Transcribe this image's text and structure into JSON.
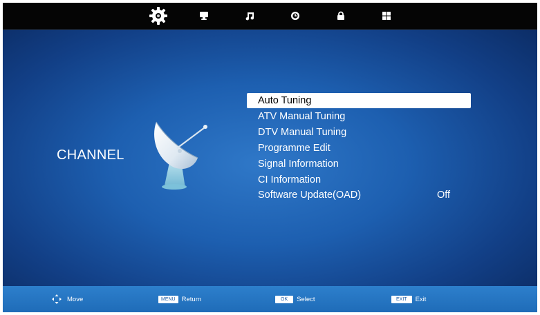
{
  "top_tabs": [
    {
      "icon": "gear-icon",
      "selected": true
    },
    {
      "icon": "monitor-icon",
      "selected": false
    },
    {
      "icon": "music-note-icon",
      "selected": false
    },
    {
      "icon": "clock-icon",
      "selected": false
    },
    {
      "icon": "lock-icon",
      "selected": false
    },
    {
      "icon": "grid-icon",
      "selected": false
    }
  ],
  "section": {
    "title": "CHANNEL",
    "illustration": "satellite-dish-icon"
  },
  "menu": {
    "items": [
      {
        "label": "Auto Tuning",
        "value": "",
        "selected": true
      },
      {
        "label": "ATV Manual Tuning",
        "value": "",
        "selected": false
      },
      {
        "label": "DTV Manual Tuning",
        "value": "",
        "selected": false
      },
      {
        "label": "Programme Edit",
        "value": "",
        "selected": false
      },
      {
        "label": "Signal Information",
        "value": "",
        "selected": false
      },
      {
        "label": "CI Information",
        "value": "",
        "selected": false
      },
      {
        "label": "Software Update(OAD)",
        "value": "Off",
        "selected": false
      }
    ]
  },
  "footer": {
    "move": {
      "icon": "arrows-icon",
      "label": "Move"
    },
    "return": {
      "key": "MENU",
      "label": "Return"
    },
    "select": {
      "key": "OK",
      "label": "Select"
    },
    "exit": {
      "key": "EXIT",
      "label": "Exit"
    }
  },
  "colors": {
    "background": "#1d5fb0",
    "topbar": "#050505",
    "footer": "#2d7fcc",
    "highlight": "#ffffff"
  }
}
